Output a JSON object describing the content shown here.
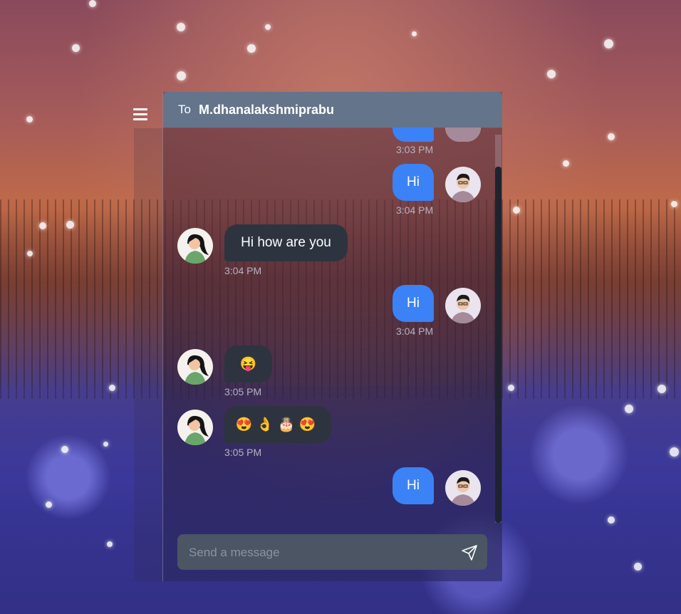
{
  "app": {
    "recipient_prefix": "To",
    "recipient_name": "M.dhanalakshmiprabu"
  },
  "messages": [
    {
      "direction": "sent",
      "text": "",
      "time": "3:03 PM"
    },
    {
      "direction": "sent",
      "text": "Hi",
      "time": "3:04 PM"
    },
    {
      "direction": "received",
      "text": "Hi how are you",
      "time": "3:04 PM"
    },
    {
      "direction": "sent",
      "text": "Hi",
      "time": "3:04 PM"
    },
    {
      "direction": "received",
      "text": "😝",
      "time": "3:05 PM"
    },
    {
      "direction": "received",
      "text": "😍👌🎂😍",
      "time": "3:05 PM"
    },
    {
      "direction": "sent",
      "text": "Hi",
      "time": ""
    }
  ],
  "composer": {
    "placeholder": "Send a message",
    "value": ""
  },
  "icons": {
    "menu": "hamburger-icon",
    "send": "send-icon"
  },
  "colors": {
    "header": "#64748b",
    "sent_bubble": "#3b82f6",
    "received_bubble": "#2d3440",
    "composer": "#4b5563"
  }
}
